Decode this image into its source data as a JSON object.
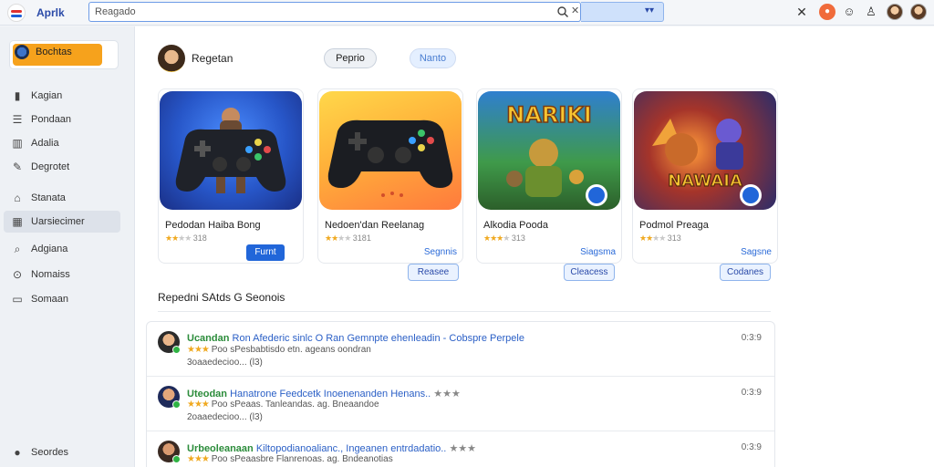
{
  "topbar": {
    "app_title": "Aprlk",
    "search_value": "Reagado",
    "search_clear": "✕",
    "dropdown_arrow": "▾▾",
    "icons": [
      "close-icon",
      "notification-icon",
      "user-icon",
      "bell-icon"
    ],
    "accent": "#2166d9"
  },
  "sidebar": {
    "profile_label": "Bochtas",
    "items": [
      {
        "label": "Kagian",
        "icon": "home-icon"
      },
      {
        "label": "Pondaan",
        "icon": "list-icon"
      },
      {
        "label": "Adalia",
        "icon": "book-icon"
      },
      {
        "label": "Degrotet",
        "icon": "edit-icon"
      },
      {
        "label": "Stanata",
        "icon": "house-icon"
      },
      {
        "label": "Uarsiecimer",
        "icon": "grid-icon"
      },
      {
        "label": "Adgiana",
        "icon": "search-icon"
      },
      {
        "label": "Nomaiss",
        "icon": "coin-icon"
      },
      {
        "label": "Somaan",
        "icon": "monitor-icon"
      }
    ],
    "footer_label": "Seordes"
  },
  "main": {
    "title": "Regetan",
    "tabs": [
      "Peprio",
      "Nanto"
    ],
    "cards": [
      {
        "name": "Pedodan Haiba Bong",
        "stars": 2,
        "rating_text": "318",
        "action": "Furnt",
        "link": "",
        "below": ""
      },
      {
        "name": "Nedoen'dan Reelanag",
        "stars": 2,
        "rating_text": "3181",
        "action": "",
        "link": "Segnnis",
        "below": "Reasee"
      },
      {
        "name": "Alkodia Pooda",
        "stars": 3,
        "rating_text": "313",
        "action": "",
        "link": "Siagsma",
        "below": "Cleacess"
      },
      {
        "name": "Podmol Preaga",
        "stars": 2,
        "rating_text": "313",
        "action": "",
        "link": "Sagsne",
        "below": "Codanes"
      }
    ],
    "section_title": "Repedni SAtds G Seonois",
    "rows": [
      {
        "title_green": "Ucandan",
        "title_blue": "Ron Afederic sinlc O Ran Gemnpte ehenleadin - Cobspre Perpele",
        "title_tail": "",
        "sub": "Poo sPesbabtisdo etn. ageans oondran",
        "sub2": "3oaaedecioo... (l3)",
        "time": "0:3:9",
        "stars": 3
      },
      {
        "title_green": "Uteodan",
        "title_blue": "Hanatrone Feedcetk Inoenenanden Henans..",
        "title_tail": "★★★",
        "sub": "Poo sPeaas. Tanleandas. ag. Bneaandoe",
        "sub2": "2oaaedecioo... (l3)",
        "time": "0:3:9",
        "stars": 3
      },
      {
        "title_green": "Urbeoleanaan",
        "title_blue": "Kiltopodianoalianc., Ingeanen entrdadatio..",
        "title_tail": "★★★",
        "sub": "Poo sPeaasbre Flanrenoas. ag. Bndeanotias",
        "sub2": "",
        "time": "0:3:9",
        "stars": 3
      }
    ]
  }
}
